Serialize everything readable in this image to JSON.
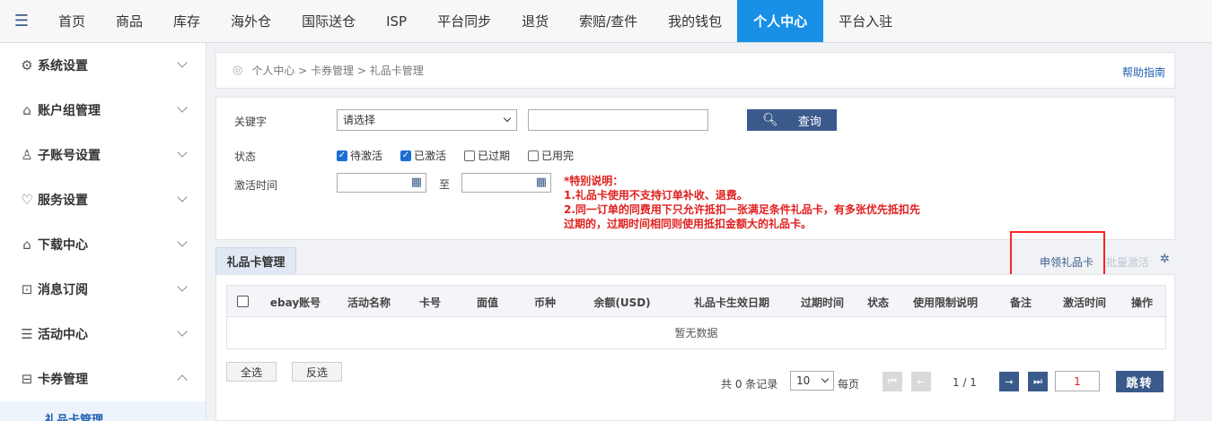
{
  "topnav": {
    "items": [
      "首页",
      "商品",
      "库存",
      "海外仓",
      "国际送仓",
      "ISP",
      "平台同步",
      "退货",
      "索赔/查件",
      "我的钱包",
      "个人中心",
      "平台入驻"
    ],
    "active": "个人中心"
  },
  "sidebar": {
    "items": [
      {
        "label": "系统设置",
        "icon": "gear-icon"
      },
      {
        "label": "账户组管理",
        "icon": "home-icon"
      },
      {
        "label": "子账号设置",
        "icon": "user-add-icon"
      },
      {
        "label": "服务设置",
        "icon": "heart-icon"
      },
      {
        "label": "下载中心",
        "icon": "home-icon"
      },
      {
        "label": "消息订阅",
        "icon": "bookmark-icon"
      },
      {
        "label": "活动中心",
        "icon": "list-icon"
      },
      {
        "label": "卡券管理",
        "icon": "gift-icon"
      }
    ],
    "subitem": "礼品卡管理"
  },
  "breadcrumb": {
    "path": "个人中心 > 卡券管理 > 礼品卡管理",
    "help": "帮助指南"
  },
  "search": {
    "keyword_label": "关键字",
    "keyword_select": "请选择",
    "keyword_value": "",
    "search_button": "查询",
    "status_label": "状态",
    "statuses": [
      {
        "label": "待激活",
        "checked": true
      },
      {
        "label": "已激活",
        "checked": true
      },
      {
        "label": "已过期",
        "checked": false
      },
      {
        "label": "已用完",
        "checked": false
      }
    ],
    "activation_label": "激活时间",
    "to_label": "至",
    "notice": [
      "*特别说明：",
      "1.礼品卡使用不支持订单补收、退费。",
      "2.同一订单的同费用下只允许抵扣一张满足条件礼品卡，有多张优先抵扣先",
      "过期的，过期时间相同则使用抵扣金额大的礼品卡。"
    ]
  },
  "grid": {
    "tab": "礼品卡管理",
    "apply_link": "申领礼品卡",
    "batch_link": "批量激活",
    "columns": [
      "ebay账号",
      "活动名称",
      "卡号",
      "面值",
      "币种",
      "余额(USD)",
      "礼品卡生效日期",
      "过期时间",
      "状态",
      "使用限制说明",
      "备注",
      "激活时间",
      "操作"
    ],
    "empty": "暂无数据",
    "select_all": "全选",
    "invert": "反选",
    "total": "共 0 条记录",
    "page_size": "10",
    "per_page": "每页",
    "page_info": "1 / 1",
    "page_input": "1",
    "go": "跳转"
  }
}
